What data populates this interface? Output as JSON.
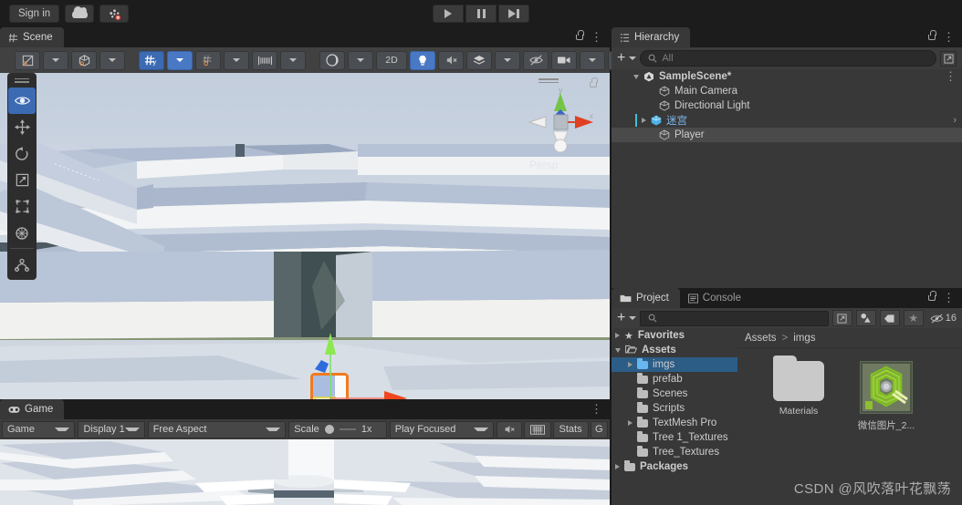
{
  "app": {
    "name": "Unity Editor",
    "theme": "dark",
    "accent": "#3c6ab3",
    "panel_bg": "#383838",
    "toolbar_bg": "#414141",
    "window_bg": "#1c1c1c",
    "selection_blue": "#2c5d87",
    "prefab_blue": "#7fb4e8"
  },
  "topbar": {
    "sign_in_label": "Sign in",
    "cloud_icon": "cloud-icon",
    "account_icon": "collab-error-icon",
    "play_label": "play-icon",
    "pause_label": "pause-icon",
    "step_label": "step-icon"
  },
  "scene_panel": {
    "tab_label": "Scene",
    "tab_icon": "scene-grid-icon",
    "lock_icon": "lock-icon",
    "menu_icon": "kebab-menu-icon",
    "toolbar": {
      "tools": [
        {
          "name": "view-tool",
          "icon": "eye-icon",
          "active": true
        },
        {
          "name": "move-tool",
          "icon": "move-arrows-icon",
          "active": false
        },
        {
          "name": "rotate-tool",
          "icon": "rotate-icon",
          "active": false
        },
        {
          "name": "scale-tool",
          "icon": "scale-icon",
          "active": false
        },
        {
          "name": "rect-tool",
          "icon": "rect-transform-icon",
          "active": false
        },
        {
          "name": "transform-tool",
          "icon": "move-rotate-scale-icon",
          "active": false
        },
        {
          "name": "custom-editor-tool",
          "icon": "joint-icon",
          "active": false
        }
      ],
      "pivot_label": "pivot-toggle",
      "handle_label": "global-local-toggle",
      "grid_label": "grid-visibility",
      "snap_label": "grid-snapping",
      "ruler_label": "scene-ruler",
      "draw_mode_label": "shaded-draw-mode",
      "twod_label": "2D",
      "lighting_label": "scene-lighting-toggle",
      "audio_label": "scene-audio-toggle",
      "fx_label": "effects-toggle",
      "hidden_label": "hidden-objects-toggle",
      "camera_label": "scene-camera-settings",
      "gizmos_label": "gizmos-toggle"
    },
    "gizmo": {
      "persp_label": "Persp",
      "y_axis_label": "y",
      "x_axis_label": "x",
      "lock_icon": "gizmo-lock-icon"
    }
  },
  "game_panel": {
    "tab_label": "Game",
    "tab_icon": "gamepad-icon",
    "controls": {
      "target_display_value": "Game",
      "display_value": "Display 1",
      "aspect_value": "Free Aspect",
      "scale_label": "Scale",
      "scale_value": "1x",
      "play_mode_value": "Play Focused",
      "mute_audio_label": "mute-audio-icon",
      "device_sim_label": "device-simulator-icon",
      "stats_label": "Stats",
      "gizmos_label": "G"
    }
  },
  "hierarchy_panel": {
    "tab_label": "Hierarchy",
    "tab_icon": "hierarchy-icon",
    "lock_icon": "lock-icon",
    "menu_icon": "kebab-menu-icon",
    "create_label": "+",
    "search_placeholder": "All",
    "search_value": "",
    "search_icon": "search-icon",
    "filter_icon": "filter-expand-icon",
    "items": [
      {
        "label": "SampleScene*",
        "depth": 0,
        "icon": "unity-scene-icon",
        "expanded": true,
        "selected": false,
        "prefab": false,
        "kebab": true
      },
      {
        "label": "Main Camera",
        "depth": 1,
        "icon": "gameobject-icon",
        "expanded": null,
        "selected": false,
        "prefab": false,
        "kebab": false
      },
      {
        "label": "Directional Light",
        "depth": 1,
        "icon": "gameobject-icon",
        "expanded": null,
        "selected": false,
        "prefab": false,
        "kebab": false
      },
      {
        "label": "迷宫",
        "depth": 1,
        "icon": "prefab-icon",
        "expanded": false,
        "selected": false,
        "prefab": true,
        "kebab": false
      },
      {
        "label": "Player",
        "depth": 1,
        "icon": "gameobject-icon",
        "expanded": null,
        "selected": true,
        "prefab": false,
        "kebab": false
      }
    ]
  },
  "project_panel": {
    "tabs": [
      {
        "label": "Project",
        "icon": "folder-icon",
        "active": true
      },
      {
        "label": "Console",
        "icon": "console-icon",
        "active": false
      }
    ],
    "lock_icon": "lock-icon",
    "menu_icon": "kebab-menu-icon",
    "create_label": "+",
    "search_placeholder": "",
    "search_value": "",
    "search_icon": "search-icon",
    "toolbar_buttons": [
      {
        "name": "filter-expand-icon",
        "label": ""
      },
      {
        "name": "search-by-type-icon",
        "label": ""
      },
      {
        "name": "search-by-label-icon",
        "label": ""
      },
      {
        "name": "favorite-star-icon",
        "label": ""
      }
    ],
    "hidden_count_label": "16",
    "hidden_count_icon": "hidden-packages-icon",
    "tree": [
      {
        "label": "Favorites",
        "depth": 0,
        "icon": "star-icon",
        "expanded": false,
        "selected": false,
        "bold": true
      },
      {
        "label": "Assets",
        "depth": 0,
        "icon": "folder-open-icon",
        "expanded": true,
        "selected": false,
        "bold": true
      },
      {
        "label": "imgs",
        "depth": 1,
        "icon": "folder-blue-icon",
        "expanded": false,
        "selected": true,
        "bold": false
      },
      {
        "label": "prefab",
        "depth": 1,
        "icon": "folder-icon",
        "expanded": null,
        "selected": false,
        "bold": false
      },
      {
        "label": "Scenes",
        "depth": 1,
        "icon": "folder-icon",
        "expanded": null,
        "selected": false,
        "bold": false
      },
      {
        "label": "Scripts",
        "depth": 1,
        "icon": "folder-icon",
        "expanded": null,
        "selected": false,
        "bold": false
      },
      {
        "label": "TextMesh Pro",
        "depth": 1,
        "icon": "folder-icon",
        "expanded": false,
        "selected": false,
        "bold": false
      },
      {
        "label": "Tree 1_Textures",
        "depth": 1,
        "icon": "folder-icon",
        "expanded": null,
        "selected": false,
        "bold": false
      },
      {
        "label": "Tree_Textures",
        "depth": 1,
        "icon": "folder-icon",
        "expanded": null,
        "selected": false,
        "bold": false
      },
      {
        "label": "Packages",
        "depth": 0,
        "icon": "folder-icon",
        "expanded": false,
        "selected": false,
        "bold": true
      }
    ],
    "breadcrumb": [
      "Assets",
      "imgs"
    ],
    "breadcrumb_separator": ">",
    "assets": [
      {
        "label": "Materials",
        "type": "folder"
      },
      {
        "label": "微信图片_2...",
        "type": "texture-maze"
      }
    ]
  },
  "watermark": {
    "text": "CSDN @风吹落叶花飘荡"
  }
}
